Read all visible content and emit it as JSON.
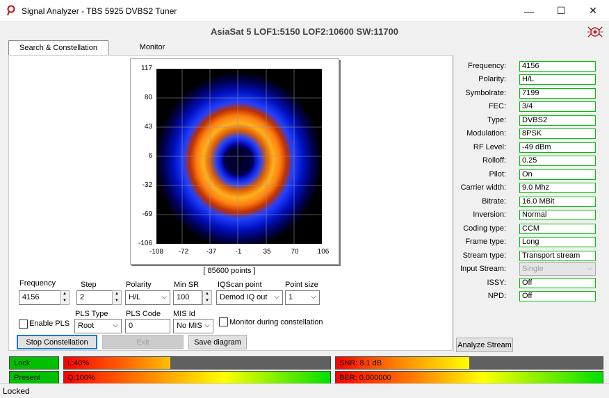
{
  "window": {
    "title": "Signal Analyzer - TBS 5925 DVBS2 Tuner",
    "minimize_label": "—",
    "maximize_label": "☐",
    "close_label": "✕"
  },
  "header": {
    "title": "AsiaSat 5 LOF1:5150 LOF2:10600 SW:11700"
  },
  "tabs": [
    {
      "label": "Search & Constellation",
      "active": true
    },
    {
      "label": "Monitor",
      "active": false
    }
  ],
  "plot": {
    "y_ticks": [
      "117",
      "80",
      "43",
      "6",
      "-32",
      "-69",
      "-106"
    ],
    "x_ticks": [
      "-108",
      "-72",
      "-37",
      "-1",
      "35",
      "70",
      "106"
    ],
    "points_label": "[ 85600 points ]"
  },
  "controls": {
    "frequency": {
      "label": "Frequency",
      "value": "4156"
    },
    "step": {
      "label": "Step",
      "value": "2"
    },
    "polarity": {
      "label": "Polarity",
      "value": "H/L"
    },
    "min_sr": {
      "label": "Min SR",
      "value": "100"
    },
    "iqscan": {
      "label": "IQScan point",
      "value": "Demod IQ out"
    },
    "point_size": {
      "label": "Point size",
      "value": "1"
    },
    "enable_pls": {
      "label": "Enable PLS",
      "checked": false
    },
    "pls_type": {
      "label": "PLS Type",
      "value": "Root"
    },
    "pls_code": {
      "label": "PLS Code",
      "value": "0"
    },
    "mis_id": {
      "label": "MIS Id",
      "value": "No MIS"
    },
    "monitor_during": {
      "label": "Monitor during constellation",
      "checked": false
    }
  },
  "buttons": {
    "stop_constellation": "Stop Constellation",
    "exit": "Exit",
    "save_diagram": "Save diagram",
    "analyze_stream": "Analyze Stream"
  },
  "properties": [
    {
      "label": "Frequency:",
      "value": "4156"
    },
    {
      "label": "Polarity:",
      "value": "H/L"
    },
    {
      "label": "Symbolrate:",
      "value": "7199"
    },
    {
      "label": "FEC:",
      "value": "3/4"
    },
    {
      "label": "Type:",
      "value": "DVBS2"
    },
    {
      "label": "Modulation:",
      "value": "8PSK"
    },
    {
      "label": "RF Level:",
      "value": "-49 dBm"
    },
    {
      "label": "Rolloff:",
      "value": "0.25"
    },
    {
      "label": "Pilot:",
      "value": "On"
    },
    {
      "label": "Carrier width:",
      "value": "9.0 Mhz"
    },
    {
      "label": "Bitrate:",
      "value": "16.0 MBit"
    },
    {
      "label": "Inversion:",
      "value": "Normal"
    },
    {
      "label": "Coding type:",
      "value": "CCM"
    },
    {
      "label": "Frame type:",
      "value": "Long"
    },
    {
      "label": "Stream type:",
      "value": "Transport stream"
    },
    {
      "label": "Input Stream:",
      "value": "Single"
    },
    {
      "label": "ISSY:",
      "value": "Off"
    },
    {
      "label": "NPD:",
      "value": "Off"
    }
  ],
  "meters": {
    "lock": "Lock",
    "present": "Present",
    "level": {
      "text": "L:40%",
      "fraction": 0.4
    },
    "quality": {
      "text": "Q:100%",
      "fraction": 1.0
    },
    "snr": {
      "text": "SNR: 8.1 dB",
      "fraction": 0.5
    },
    "ber": {
      "text": "BER: 0.000000",
      "fraction": 1.0
    }
  },
  "status": {
    "text": "Locked"
  },
  "colors": {
    "led_green": "#00c000",
    "accent_blue": "#0078d7"
  }
}
